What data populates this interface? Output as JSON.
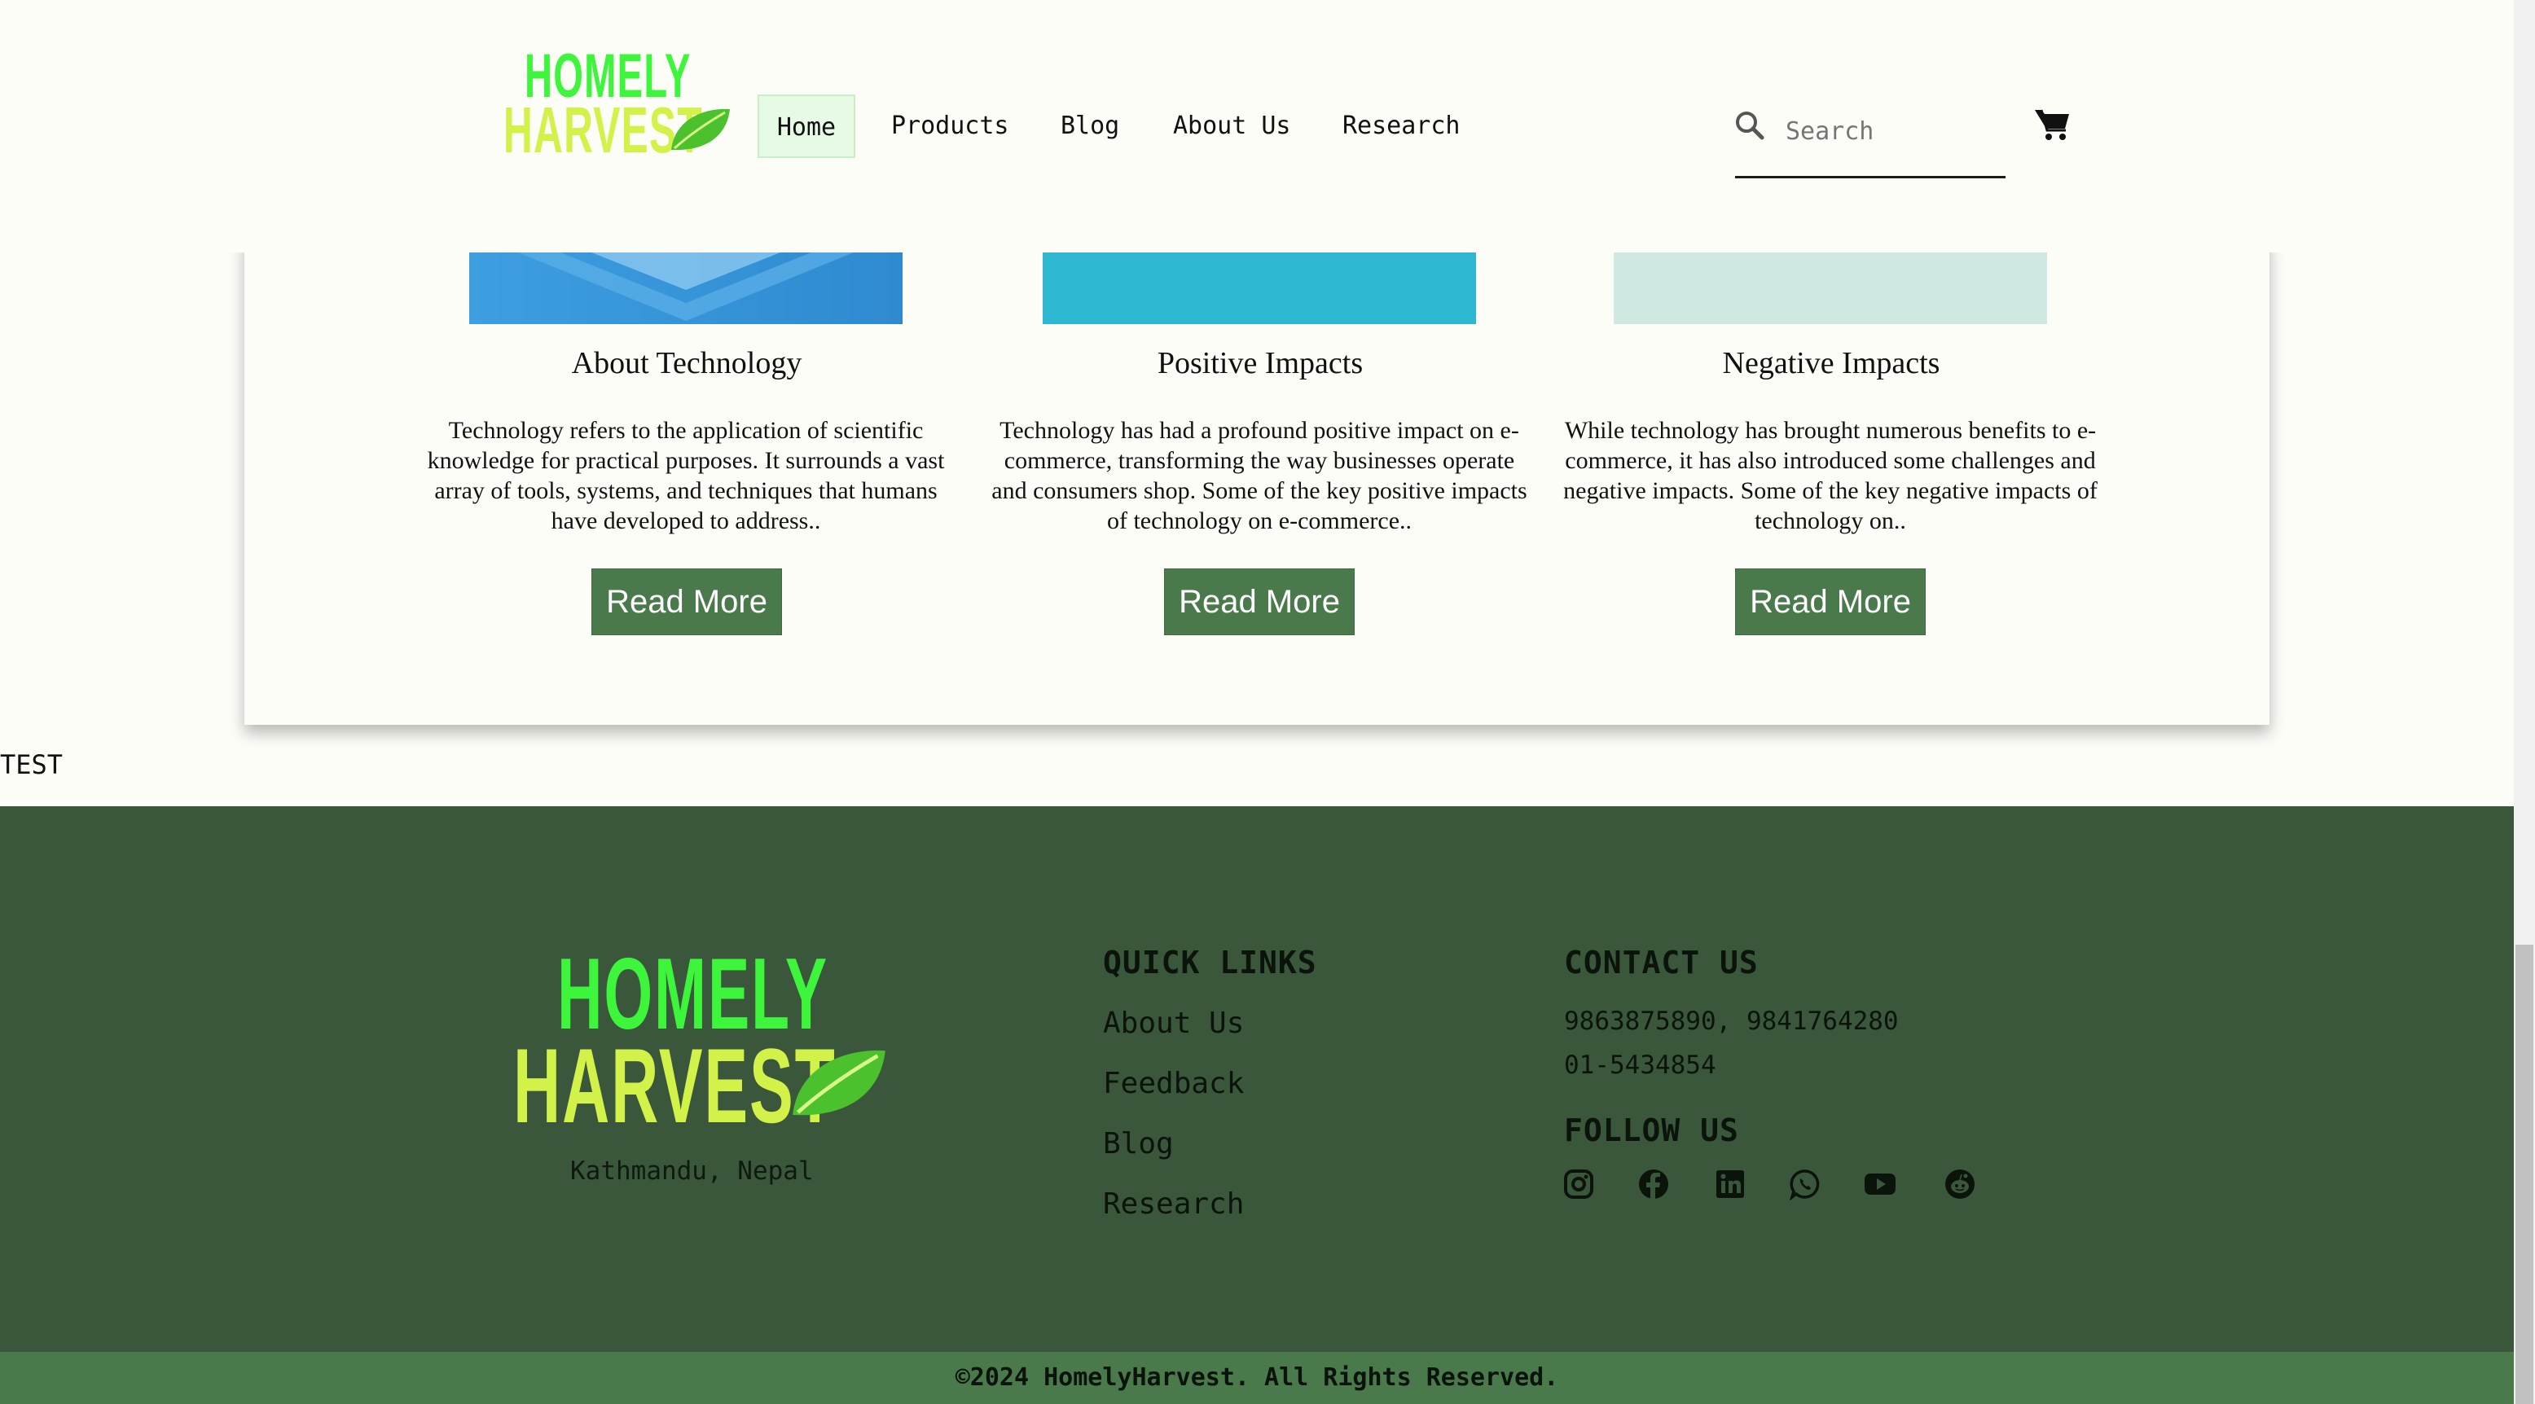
{
  "header": {
    "logo_top": "HOMELY",
    "logo_bottom": "HARVEST",
    "nav": [
      "Home",
      "Products",
      "Blog",
      "About Us",
      "Research"
    ],
    "search_placeholder": "Search"
  },
  "articles": [
    {
      "title": "About Technology",
      "text": "Technology refers to the application of scientific knowledge for practical purposes. It surrounds a vast array of tools, systems, and techniques that humans have developed to address..",
      "button": "Read More"
    },
    {
      "title": "Positive Impacts",
      "text": "Technology has had a profound positive impact on e-commerce, transforming the way businesses operate and consumers shop. Some of the key positive impacts of technology on e-commerce..",
      "button": "Read More"
    },
    {
      "title": "Negative Impacts",
      "text": "While technology has brought numerous benefits to e-commerce, it has also introduced some challenges and negative impacts. Some of the key negative impacts of technology on..",
      "button": "Read More"
    }
  ],
  "test_label": "TEST",
  "footer": {
    "logo_top": "HOMELY",
    "logo_bottom": "HARVEST",
    "location": "Kathmandu, Nepal",
    "quick_links_heading": "QUICK LINKS",
    "quick_links": [
      "About Us",
      "Feedback",
      "Blog",
      "Research"
    ],
    "contact_heading": "CONTACT US",
    "phones": "9863875890, 9841764280",
    "landline": "01-5434854",
    "follow_heading": "FOLLOW US",
    "social_icons": [
      "instagram-icon",
      "facebook-icon",
      "linkedin-icon",
      "whatsapp-icon",
      "youtube-icon",
      "reddit-icon"
    ],
    "copyright": "©2024 HomelyHarvest. All Rights Reserved."
  },
  "colors": {
    "footer_bg": "#3a573c",
    "button_bg": "#4a7a4c",
    "logo_green": "#3df53a",
    "logo_yellow": "#d2f24a"
  }
}
